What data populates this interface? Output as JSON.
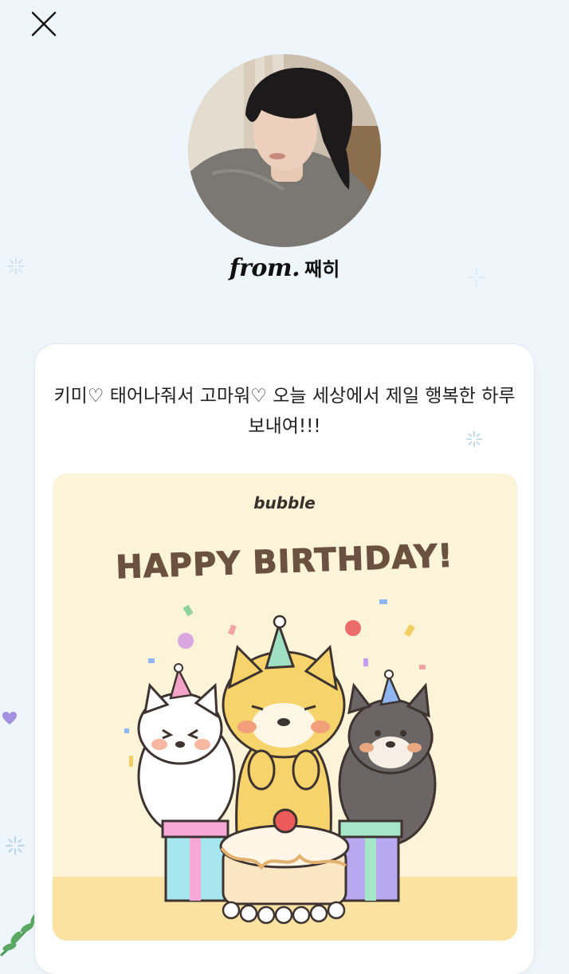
{
  "header": {
    "close_icon": "close-icon"
  },
  "profile": {
    "from_label": "from.",
    "sender_name": "째히"
  },
  "card": {
    "message": "키미♡ 태어나줘서 고마워♡ 오늘 세상에서 제일 행복한 하루 보내여!!!",
    "image": {
      "brand": "bubble",
      "headline": "HAPPY BIRTHDAY!"
    }
  },
  "colors": {
    "background": "#eef5fb",
    "card": "#ffffff",
    "image_bg": "#fbf4d8",
    "headline": "#6b5140"
  }
}
